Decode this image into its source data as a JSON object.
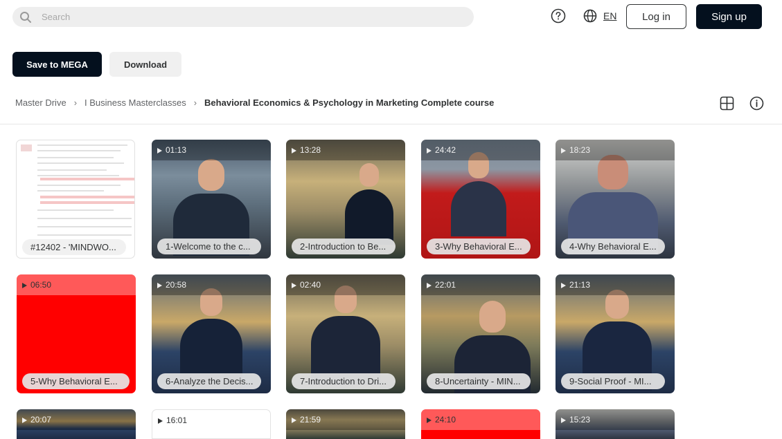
{
  "search": {
    "placeholder": "Search"
  },
  "header": {
    "language": "EN",
    "login_label": "Log in",
    "signup_label": "Sign up"
  },
  "actions": {
    "save_label": "Save to MEGA",
    "download_label": "Download"
  },
  "breadcrumb": [
    "Master Drive",
    "I Business Masterclasses",
    "Behavioral Economics & Psychology in Marketing Complete course"
  ],
  "tiles": [
    {
      "name": "#12402 - 'MINDWO...",
      "duration": ""
    },
    {
      "name": "1-Welcome to the c...",
      "duration": "01:13"
    },
    {
      "name": "2-Introduction to Be...",
      "duration": "13:28"
    },
    {
      "name": "3-Why Behavioral E...",
      "duration": "24:42"
    },
    {
      "name": "4-Why Behavioral E...",
      "duration": "18:23"
    },
    {
      "name": "5-Why Behavioral E...",
      "duration": "06:50"
    },
    {
      "name": "6-Analyze the Decis...",
      "duration": "20:58"
    },
    {
      "name": "7-Introduction to Dri...",
      "duration": "02:40"
    },
    {
      "name": "8-Uncertainty - MIN...",
      "duration": "22:01"
    },
    {
      "name": "9-Social Proof - MI...",
      "duration": "21:13"
    },
    {
      "name": "",
      "duration": "20:07"
    },
    {
      "name": "",
      "duration": "16:01"
    },
    {
      "name": "",
      "duration": "21:59"
    },
    {
      "name": "",
      "duration": "24:10"
    },
    {
      "name": "",
      "duration": "15:23"
    }
  ]
}
